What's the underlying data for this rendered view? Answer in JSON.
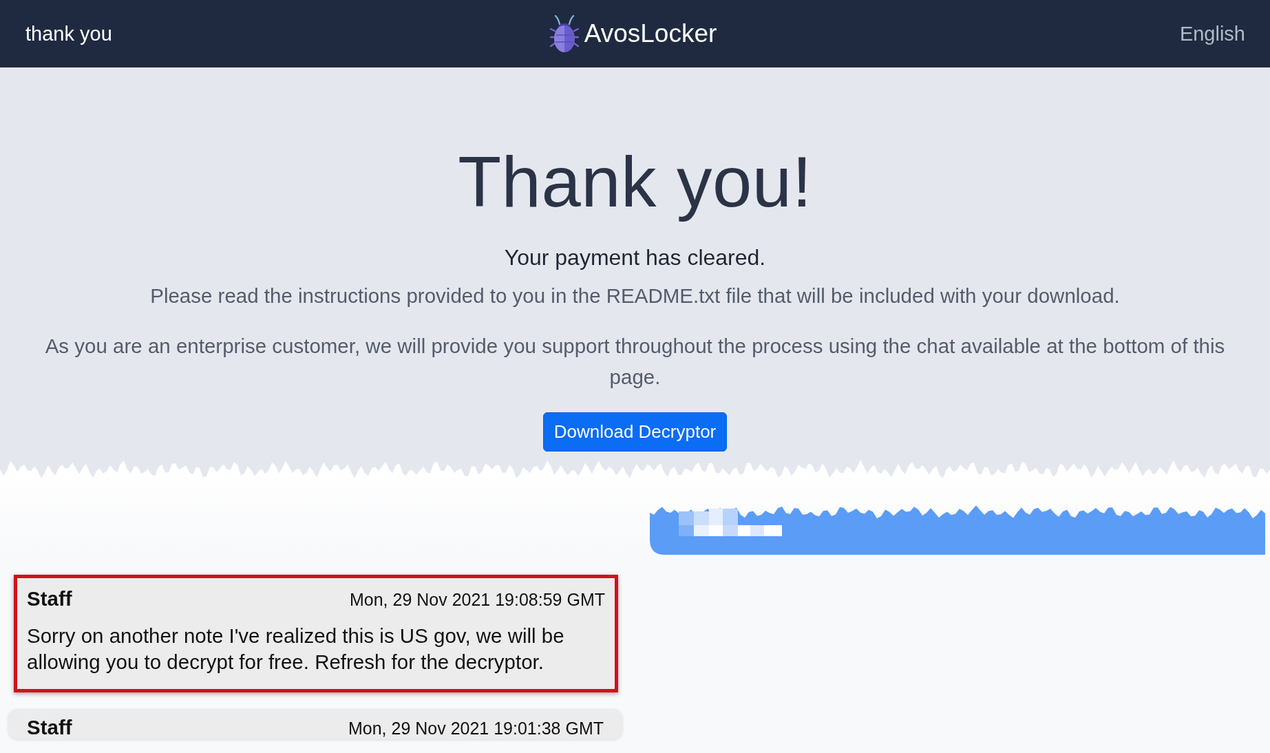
{
  "navbar": {
    "title": "thank you",
    "brand": "AvosLocker",
    "language": "English"
  },
  "hero": {
    "heading": "Thank you!",
    "subheading": "Your payment has cleared.",
    "paragraphs": [
      "Please read the instructions provided to you in the README.txt file that will be included with your download.",
      "As you are an enterprise customer, we will provide you support throughout the process using the chat available at the bottom of this page."
    ],
    "button": "Download Decryptor"
  },
  "chat": {
    "messages": [
      {
        "sender": "Staff",
        "time": "Mon, 29 Nov 2021 19:08:59 GMT",
        "text": "Sorry on another note I've realized this is US gov, we will be allowing you to decrypt for free. Refresh for the decryptor.",
        "highlighted": true
      },
      {
        "sender": "Staff",
        "time": "Mon, 29 Nov 2021 19:01:38 GMT",
        "highlighted": false
      }
    ]
  }
}
